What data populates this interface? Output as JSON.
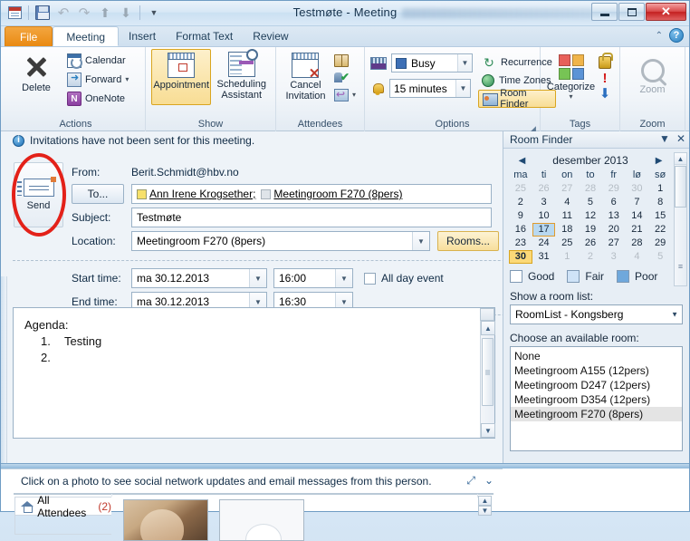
{
  "window": {
    "title": "Testmøte - Meeting",
    "minimize_label": "Minimize",
    "maximize_label": "Maximize",
    "close_label": "✕"
  },
  "quick_access": {
    "calendar_icon": "calendar-icon",
    "save_icon": "save-icon",
    "undo_icon": "undo-icon",
    "redo_icon": "redo-icon",
    "previous_icon": "previous-item-icon",
    "next_icon": "next-item-icon",
    "customize_icon": "chevron-down-icon"
  },
  "tabs": [
    {
      "label": "File",
      "type": "file"
    },
    {
      "label": "Meeting",
      "type": "active"
    },
    {
      "label": "Insert",
      "type": "normal"
    },
    {
      "label": "Format Text",
      "type": "normal"
    },
    {
      "label": "Review",
      "type": "normal"
    }
  ],
  "ribbon": {
    "collapse_icon": "chevron-up-icon",
    "help_icon": "help-icon",
    "help_glyph": "?",
    "groups": [
      {
        "name": "Actions",
        "label": "Actions",
        "big_button": "Delete",
        "items": [
          "Calendar",
          "Forward",
          "OneNote"
        ]
      },
      {
        "name": "Show",
        "label": "Show",
        "buttons": [
          "Appointment",
          "Scheduling Assistant"
        ]
      },
      {
        "name": "Attendees",
        "label": "Attendees",
        "big_button": "Cancel Invitation"
      },
      {
        "name": "Options",
        "label": "Options",
        "show_as": "Busy",
        "reminder": "15 minutes",
        "recurrence": "Recurrence",
        "time_zones": "Time Zones",
        "room_finder": "Room Finder"
      },
      {
        "name": "Tags",
        "label": "Tags",
        "categorize": "Categorize"
      },
      {
        "name": "Zoom",
        "label": "Zoom",
        "zoom": "Zoom"
      }
    ]
  },
  "infobar": {
    "text": "Invitations have not been sent for this meeting.",
    "icon": "info-icon"
  },
  "form": {
    "send_label": "Send",
    "from_label": "From:",
    "from_value": "Berit.Schmidt@hbv.no",
    "to_label": "To...",
    "to_recipients": [
      {
        "name": "Ann Irene Krogsether;",
        "chip": "yellow"
      },
      {
        "name": "Meetingroom F270 (8pers)",
        "chip": "grey"
      }
    ],
    "subject_label": "Subject:",
    "subject_value": "Testmøte",
    "location_label": "Location:",
    "location_value": "Meetingroom F270 (8pers)",
    "rooms_label": "Rooms...",
    "start_label": "Start time:",
    "start_date": "ma 30.12.2013",
    "start_time": "16:00",
    "end_label": "End time:",
    "end_date": "ma 30.12.2013",
    "end_time": "16:30",
    "all_day_label": "All day event",
    "all_day_checked": false
  },
  "body": {
    "line1": "Agenda:",
    "item1_num": "1.",
    "item1_text": "Testing",
    "item2_num": "2.",
    "item2_text": ""
  },
  "social": {
    "hint": "Click on a photo to see social network updates and email messages from this person.",
    "expand_icon": "expand-icon",
    "collapse_icon": "chevron-down-icon",
    "all_attendees": "All Attendees",
    "all_attendees_count": "(2)"
  },
  "room_finder": {
    "title": "Room Finder",
    "menu_icon": "chevron-down-icon",
    "close_icon": "close-icon",
    "calendar": {
      "month": "desember 2013",
      "prev_icon": "previous-month-icon",
      "next_icon": "next-month-icon",
      "weekdays": [
        "ma",
        "ti",
        "on",
        "to",
        "fr",
        "lø",
        "sø"
      ],
      "weeks": [
        [
          {
            "d": "25",
            "s": "out"
          },
          {
            "d": "26",
            "s": "out"
          },
          {
            "d": "27",
            "s": "out"
          },
          {
            "d": "28",
            "s": "out"
          },
          {
            "d": "29",
            "s": "out"
          },
          {
            "d": "30",
            "s": "out"
          },
          {
            "d": "1",
            "s": "in"
          }
        ],
        [
          {
            "d": "2",
            "s": "in"
          },
          {
            "d": "3",
            "s": "in"
          },
          {
            "d": "4",
            "s": "in"
          },
          {
            "d": "5",
            "s": "in"
          },
          {
            "d": "6",
            "s": "in"
          },
          {
            "d": "7",
            "s": "in"
          },
          {
            "d": "8",
            "s": "in"
          }
        ],
        [
          {
            "d": "9",
            "s": "in"
          },
          {
            "d": "10",
            "s": "in"
          },
          {
            "d": "11",
            "s": "in"
          },
          {
            "d": "12",
            "s": "in"
          },
          {
            "d": "13",
            "s": "in"
          },
          {
            "d": "14",
            "s": "in"
          },
          {
            "d": "15",
            "s": "in"
          }
        ],
        [
          {
            "d": "16",
            "s": "in"
          },
          {
            "d": "17",
            "s": "sel"
          },
          {
            "d": "18",
            "s": "in"
          },
          {
            "d": "19",
            "s": "in"
          },
          {
            "d": "20",
            "s": "in"
          },
          {
            "d": "21",
            "s": "in"
          },
          {
            "d": "22",
            "s": "in"
          }
        ],
        [
          {
            "d": "23",
            "s": "in"
          },
          {
            "d": "24",
            "s": "in"
          },
          {
            "d": "25",
            "s": "in"
          },
          {
            "d": "26",
            "s": "in"
          },
          {
            "d": "27",
            "s": "in"
          },
          {
            "d": "28",
            "s": "in"
          },
          {
            "d": "29",
            "s": "in"
          }
        ],
        [
          {
            "d": "30",
            "s": "today"
          },
          {
            "d": "31",
            "s": "in"
          },
          {
            "d": "1",
            "s": "out"
          },
          {
            "d": "2",
            "s": "out"
          },
          {
            "d": "3",
            "s": "out"
          },
          {
            "d": "4",
            "s": "out"
          },
          {
            "d": "5",
            "s": "out"
          }
        ]
      ]
    },
    "legend": [
      {
        "label": "Good",
        "color": "#ffffff"
      },
      {
        "label": "Fair",
        "color": "#cfe3f7"
      },
      {
        "label": "Poor",
        "color": "#6fa8dc"
      }
    ],
    "room_list_label": "Show a room list:",
    "room_list_value": "RoomList - Kongsberg",
    "available_label": "Choose an available room:",
    "rooms": [
      {
        "label": "None",
        "selected": false
      },
      {
        "label": "Meetingroom A155 (12pers)",
        "selected": false
      },
      {
        "label": "Meetingroom D247 (12pers)",
        "selected": false
      },
      {
        "label": "Meetingroom D354 (12pers)",
        "selected": false
      },
      {
        "label": "Meetingroom F270 (8pers)",
        "selected": true
      }
    ]
  },
  "colors": {
    "accent_orange": "#e98a12",
    "annotation_red": "#e32119",
    "selected_day": "#b8d8f0",
    "today_day": "#fbd978"
  }
}
